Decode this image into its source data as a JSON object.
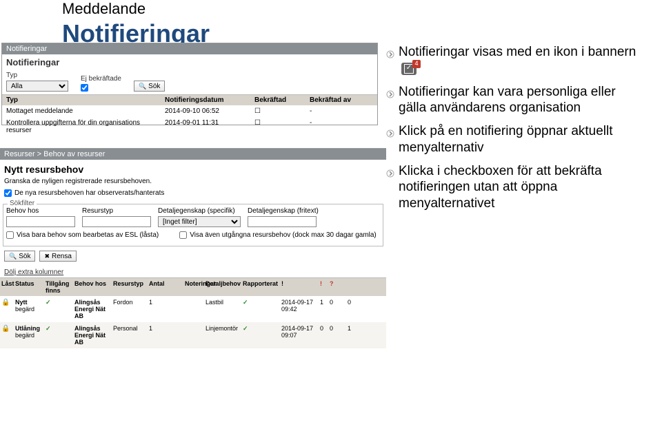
{
  "doc": {
    "title1": "Meddelande",
    "title2": "Notifieringar"
  },
  "bullets": {
    "b1": "Notifieringar visas med en ikon i bannern",
    "badge": "4",
    "b2": "Notifieringar kan vara personliga eller gälla användarens organisation",
    "b3": "Klick på en notifiering öppnar aktuellt menyalternativ",
    "b4": "Klicka i checkboxen för att bekräfta notifieringen utan att öppna menyalternativet"
  },
  "top": {
    "header": "Notifieringar",
    "sub": "Notifieringar",
    "typLabel": "Typ",
    "typValue": "Alla",
    "ejbLabel": "Ej bekräftade",
    "sok": "Sök",
    "cols": {
      "a": "Typ",
      "b": "Notifieringsdatum",
      "c": "Bekräftad",
      "d": "Bekräftad av"
    },
    "rows": [
      {
        "a": "Mottaget meddelande",
        "b": "2014-09-10 06:52",
        "c": "☐",
        "d": "-"
      },
      {
        "a": "Kontrollera uppgifterna för din organisations resurser",
        "b": "2014-09-01 11:31",
        "c": "☐",
        "d": "-"
      }
    ]
  },
  "bottom": {
    "breadcrumb": "Resurser > Behov av resurser",
    "title": "Nytt resursbehov",
    "intro": "Granska de nyligen registrerade resursbehoven.",
    "obs": "De nya resursbehoven har observerats/hanterats",
    "sokfilter": "Sökfilter",
    "f": {
      "behovHos": "Behov hos",
      "resurstyp": "Resurstyp",
      "detaljSpec": "Detaljegenskap (specifik)",
      "detaljSpecVal": "[Inget filter]",
      "detaljFri": "Detaljegenskap (fritext)",
      "chkEsl": "Visa bara behov som bearbetas av ESL (låsta)",
      "chkUtg": "Visa även utgångna resursbehov (dock max 30 dagar gamla)"
    },
    "btnSok": "Sök",
    "btnRensa": "Rensa",
    "dolj": "Dölj extra kolumner",
    "cols": {
      "c0": "Låst",
      "c1": "Status",
      "c2": "Tillgång finns",
      "c3": "Behov hos",
      "c4": "Resurstyp",
      "c5": "Antal",
      "c6": "Noteringar",
      "c7": "Detaljbehov",
      "c8": "Rapporterat",
      "c9": "!",
      "c10": "",
      "c11": ""
    },
    "rows": [
      {
        "r0": "🔒",
        "r1": "Nytt",
        "r2": "✓",
        "r3": "Alingsås Energi Nät AB",
        "r4": "Fordon",
        "r5": "1",
        "r6": "",
        "r7": "Lastbil",
        "r8": "2014-09-17 09:42",
        "r9": "✓",
        "r10": "1",
        "r11": "0",
        "r12": "0",
        "begard": "begärd"
      },
      {
        "r0": "🔒",
        "r1": "Utlåning",
        "r2": "✓",
        "r3": "Alingsås Energi Nät AB",
        "r4": "Personal",
        "r5": "1",
        "r6": "",
        "r7": "Linjemontör",
        "r8": "2014-09-17 09:07",
        "r9": "✓",
        "r10": "0",
        "r11": "0",
        "r12": "1",
        "begard": "begärd"
      }
    ]
  }
}
